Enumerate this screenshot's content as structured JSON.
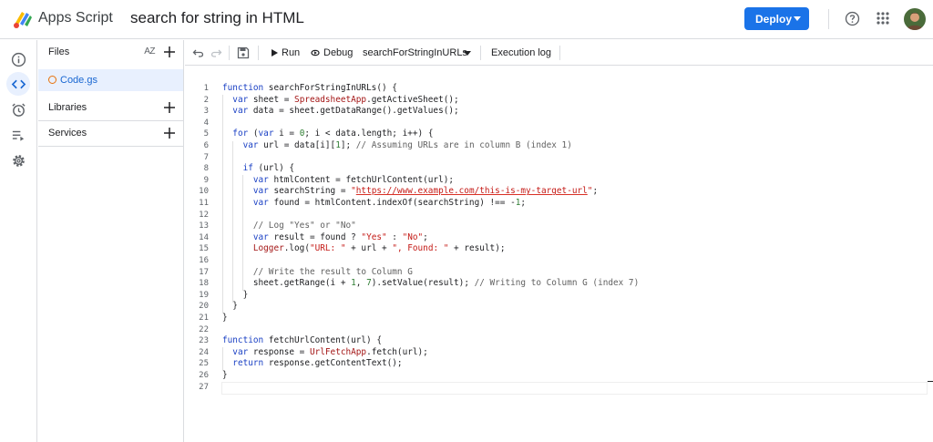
{
  "app": {
    "name": "Apps Script",
    "project_title": "search for string in HTML"
  },
  "header": {
    "deploy_label": "Deploy",
    "icons": [
      "help-icon",
      "apps-grid-icon",
      "avatar"
    ]
  },
  "rail": {
    "items": [
      "overview-icon",
      "editor-icon",
      "triggers-icon",
      "executions-icon",
      "settings-icon"
    ],
    "active": "editor-icon"
  },
  "files_panel": {
    "files_label": "Files",
    "sort_label": "AZ",
    "files": [
      "Code.gs"
    ],
    "libraries_label": "Libraries",
    "services_label": "Services"
  },
  "toolbar": {
    "run_label": "Run",
    "debug_label": "Debug",
    "function_name": "searchForStringInURLs",
    "execution_log_label": "Execution log"
  },
  "editor": {
    "line_numbers": [
      "1",
      "2",
      "3",
      "4",
      "5",
      "6",
      "7",
      "8",
      "9",
      "10",
      "11",
      "12",
      "13",
      "14",
      "15",
      "16",
      "17",
      "18",
      "19",
      "20",
      "21",
      "22",
      "23",
      "24",
      "25",
      "26",
      "27"
    ],
    "lines": [
      "function searchForStringInURLs() {",
      "  var sheet = SpreadsheetApp.getActiveSheet();",
      "  var data = sheet.getDataRange().getValues();",
      "",
      "  for (var i = 0; i < data.length; i++) {",
      "    var url = data[i][1]; // Assuming URLs are in column B (index 1)",
      "",
      "    if (url) {",
      "      var htmlContent = fetchUrlContent(url);",
      "      var searchString = \"https://www.example.com/this-is-my-target-url\";",
      "      var found = htmlContent.indexOf(searchString) !== -1;",
      "",
      "      // Log \"Yes\" or \"No\"",
      "      var result = found ? \"Yes\" : \"No\";",
      "      Logger.log(\"URL: \" + url + \", Found: \" + result);",
      "",
      "      // Write the result to Column G",
      "      sheet.getRange(i + 1, 7).setValue(result); // Writing to Column G (index 7)",
      "    }",
      "  }",
      "}",
      "",
      "function fetchUrlContent(url) {",
      "  var response = UrlFetchApp.fetch(url);",
      "  return response.getContentText();",
      "}",
      ""
    ]
  },
  "colors": {
    "accent": "#1a73e8",
    "keyword": "#1a40c4",
    "string": "#c41a16",
    "number": "#2e7d32",
    "comment": "#616161",
    "active_file": "#e8f0fe"
  }
}
